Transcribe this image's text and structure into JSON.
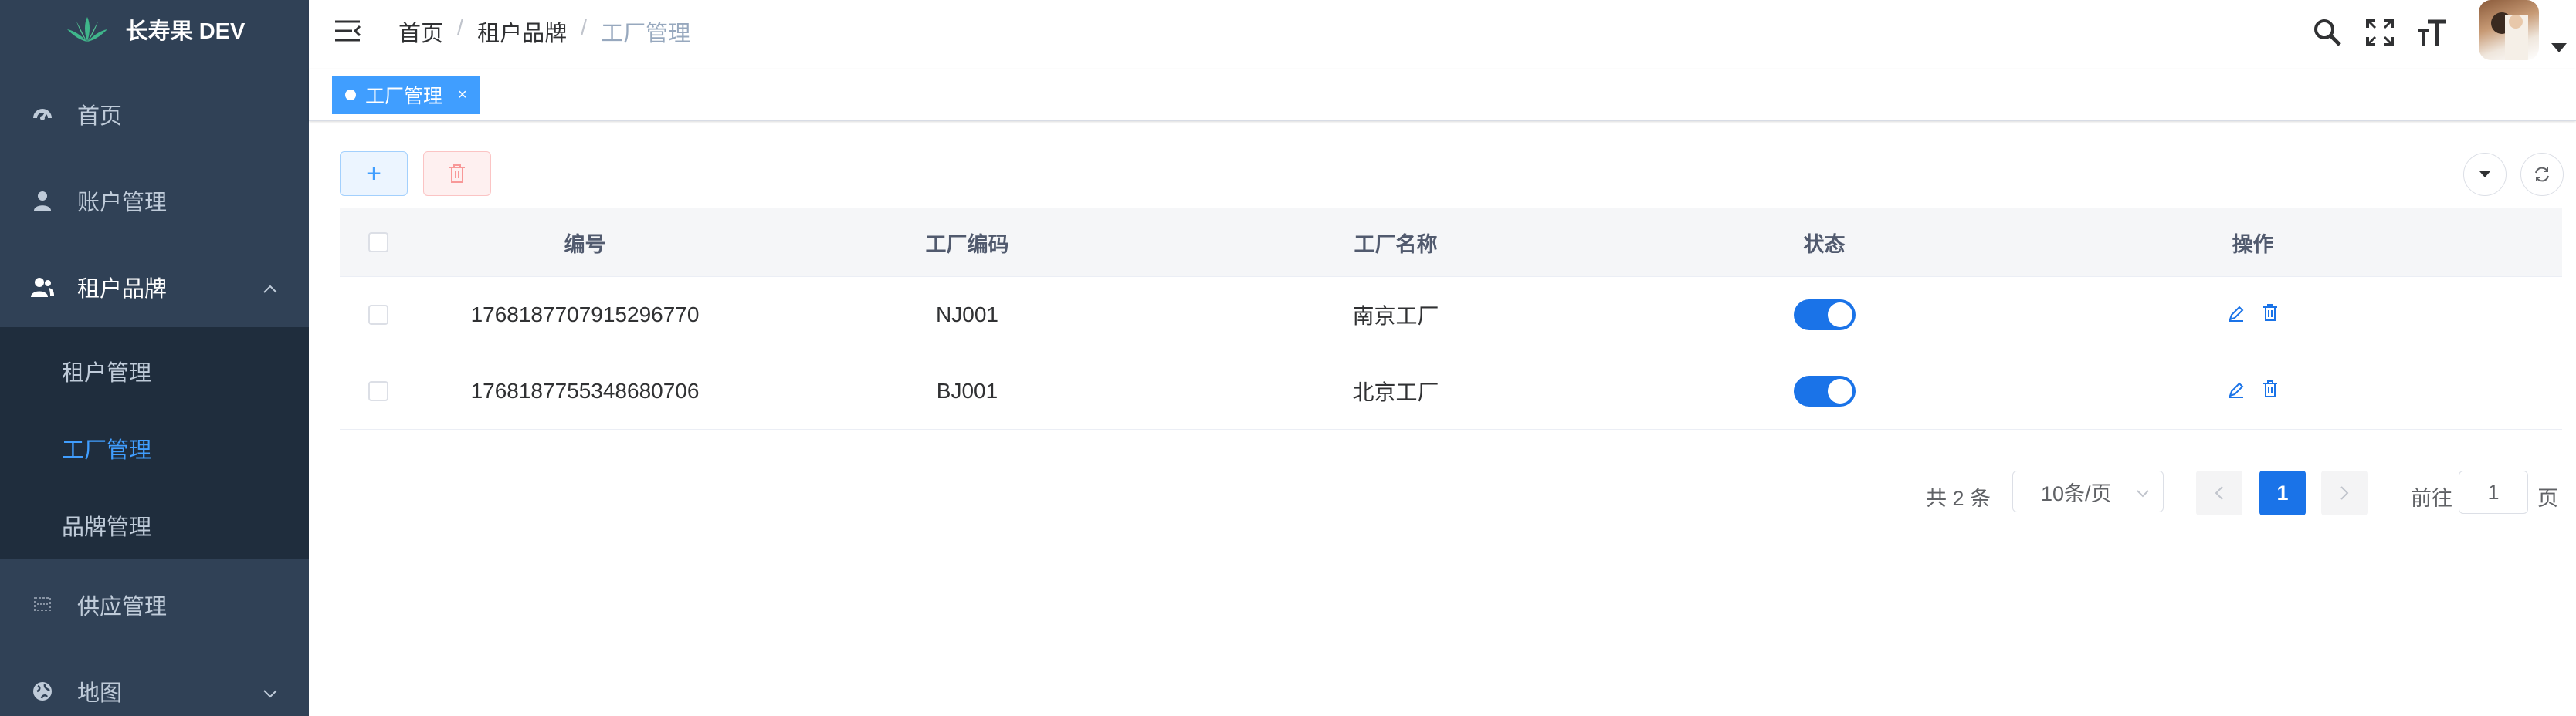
{
  "app": {
    "title": "长寿果 DEV"
  },
  "sidebar": {
    "items": [
      {
        "label": "首页",
        "icon": "dashboard-icon"
      },
      {
        "label": "账户管理",
        "icon": "user-icon"
      },
      {
        "label": "租户品牌",
        "icon": "peoples-icon",
        "expanded": true,
        "children": [
          {
            "label": "租户管理"
          },
          {
            "label": "工厂管理",
            "active": true
          },
          {
            "label": "品牌管理"
          }
        ]
      },
      {
        "label": "供应管理",
        "icon": "supply-icon"
      },
      {
        "label": "地图",
        "icon": "globe-icon"
      }
    ]
  },
  "navbar": {
    "breadcrumb": [
      "首页",
      "租户品牌",
      "工厂管理"
    ],
    "separator": "/"
  },
  "tags": [
    {
      "label": "工厂管理",
      "close": "×",
      "active": true
    }
  ],
  "toolbar": {
    "add_label": "+"
  },
  "table": {
    "columns": [
      "编号",
      "工厂编码",
      "工厂名称",
      "状态",
      "操作"
    ],
    "rows": [
      {
        "id": "1768187707915296770",
        "code": "NJ001",
        "name": "南京工厂",
        "status": true
      },
      {
        "id": "1768187755348680706",
        "code": "BJ001",
        "name": "北京工厂",
        "status": true
      }
    ]
  },
  "pagination": {
    "total_text": "共 2 条",
    "page_size": "10条/页",
    "current_page": "1",
    "goto_label": "前往",
    "goto_value": "1",
    "page_suffix": "页"
  },
  "colors": {
    "sidebar": "#304156",
    "submenu": "#1f2d3d",
    "accent": "#409eff",
    "switch_on": "#1a73e8"
  }
}
